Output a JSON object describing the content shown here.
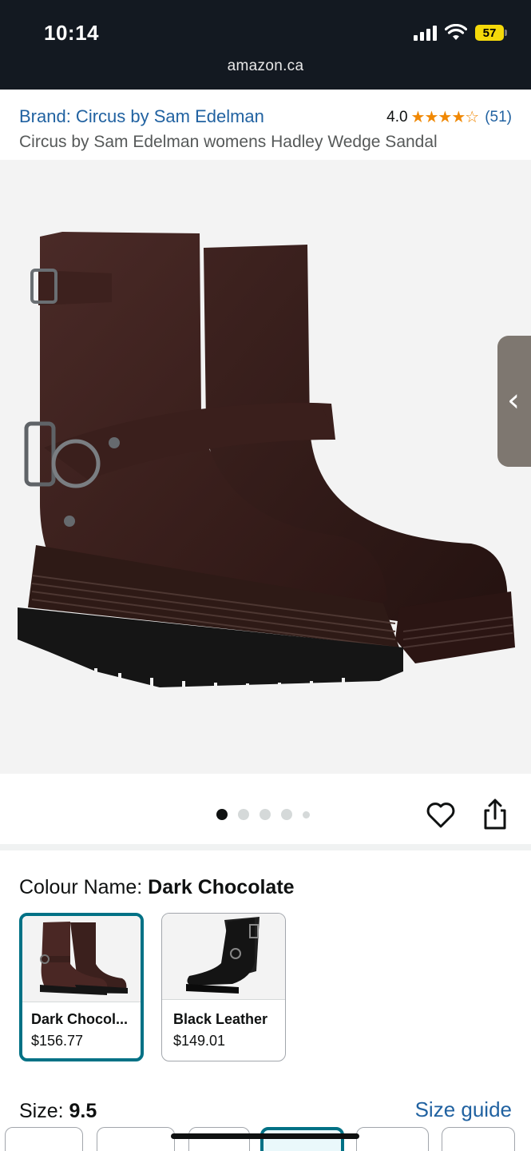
{
  "status_bar": {
    "time": "10:14",
    "battery": "57",
    "battery_color": "#f5d90a"
  },
  "browser": {
    "url": "amazon.ca"
  },
  "product": {
    "brand_link": "Brand: Circus by Sam Edelman",
    "rating_value": "4.0",
    "rating_stars": 4,
    "rating_count": "(51)",
    "title": "Circus by Sam Edelman womens Hadley Wedge Sandal"
  },
  "gallery": {
    "image_count": 5,
    "active_index": 0,
    "icon_prev": "chevron-left-icon",
    "icon_favorite": "heart-icon",
    "icon_share": "share-icon"
  },
  "colour": {
    "label": "Colour Name: ",
    "selected_value": "Dark Chocolate",
    "options": [
      {
        "name": "Dark Chocol...",
        "price": "$156.77",
        "selected": true,
        "color": "#4a2724"
      },
      {
        "name": "Black Leather",
        "price": "$149.01",
        "selected": false,
        "color": "#1a1a1a"
      }
    ]
  },
  "size": {
    "label": "Size: ",
    "selected_value": "9.5",
    "guide_link": "Size guide"
  },
  "colors": {
    "header_bg": "#131921",
    "link": "#2162a1",
    "star": "#f08804",
    "selected_border": "#007185"
  }
}
